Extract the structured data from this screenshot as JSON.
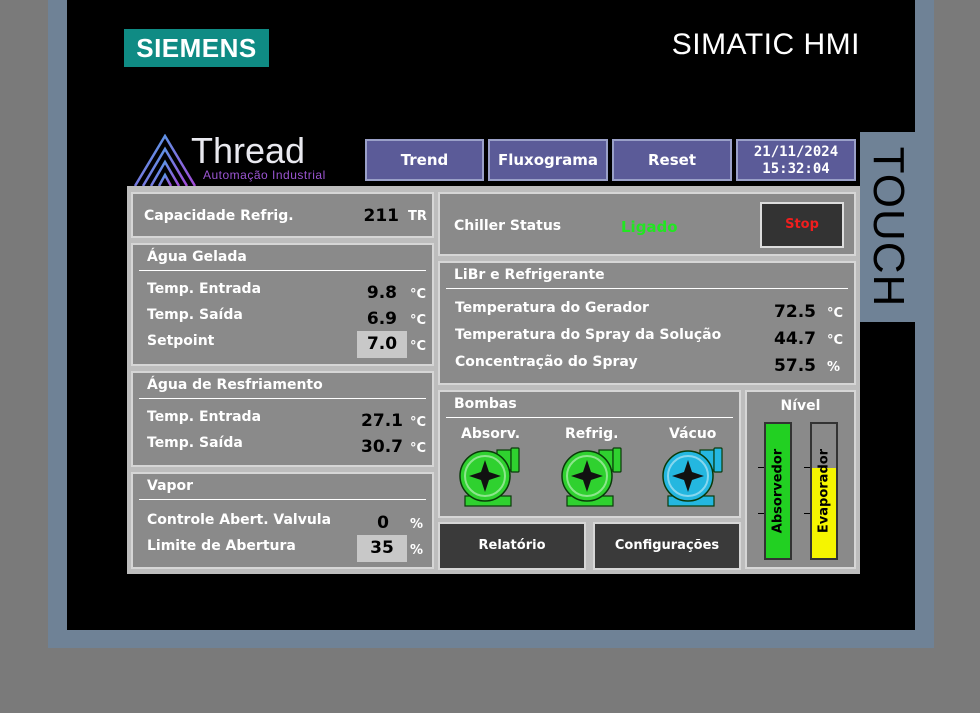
{
  "brand": {
    "siemens": "SIEMENS",
    "simatic": "SIMATIC HMI",
    "touch": "TOUCH"
  },
  "logo": {
    "name": "Thread",
    "subtitle": "Automação Industrial"
  },
  "nav": {
    "trend": "Trend",
    "fluxograma": "Fluxograma",
    "reset": "Reset"
  },
  "datetime": {
    "date": "21/11/2024",
    "time": "15:32:04"
  },
  "capacidade": {
    "label": "Capacidade Refrig.",
    "value": "211",
    "unit": "TR"
  },
  "agua_gelada": {
    "title": "Água Gelada",
    "rows": [
      {
        "label": "Temp. Entrada",
        "value": "9.8",
        "unit": "°C"
      },
      {
        "label": "Temp. Saída",
        "value": "6.9",
        "unit": "°C"
      },
      {
        "label": "Setpoint",
        "value": "7.0",
        "unit": "°C"
      }
    ]
  },
  "agua_resfriamento": {
    "title": "Água de Resfriamento",
    "rows": [
      {
        "label": "Temp. Entrada",
        "value": "27.1",
        "unit": "°C"
      },
      {
        "label": "Temp. Saída",
        "value": "30.7",
        "unit": "°C"
      }
    ]
  },
  "vapor": {
    "title": "Vapor",
    "rows": [
      {
        "label": "Controle Abert. Valvula",
        "value": "0",
        "unit": "%"
      },
      {
        "label": "Limite de Abertura",
        "value": "35",
        "unit": "%"
      }
    ]
  },
  "chiller": {
    "label": "Chiller Status",
    "status": "Ligado",
    "stop_label": "Stop"
  },
  "libr": {
    "title": "LiBr e Refrigerante",
    "rows": [
      {
        "label": "Temperatura do Gerador",
        "value": "72.5",
        "unit": "°C"
      },
      {
        "label": "Temperatura do Spray da Solução",
        "value": "44.7",
        "unit": "°C"
      },
      {
        "label": "Concentração do Spray",
        "value": "57.5",
        "unit": "%"
      }
    ]
  },
  "bombas": {
    "title": "Bombas",
    "pumps": [
      {
        "label": "Absorv.",
        "color": "#2fd12f"
      },
      {
        "label": "Refrig.",
        "color": "#2fd12f"
      },
      {
        "label": "Vácuo",
        "color": "#24b7e0"
      }
    ]
  },
  "nivel": {
    "title": "Nível",
    "bars": [
      {
        "label": "Absorvedor",
        "level_percent": 100,
        "color": "#22d022"
      },
      {
        "label": "Evaporador",
        "level_percent": 67,
        "color": "#f5f500"
      }
    ]
  },
  "buttons": {
    "relatorio": "Relatório",
    "configuracoes": "Configurações"
  },
  "colors": {
    "siemens_teal": "#0f8b84",
    "nav_button": "#5b5b98",
    "panel": "#8a8a8a",
    "status_on": "#22e622",
    "stop_text": "#f01e1e"
  }
}
